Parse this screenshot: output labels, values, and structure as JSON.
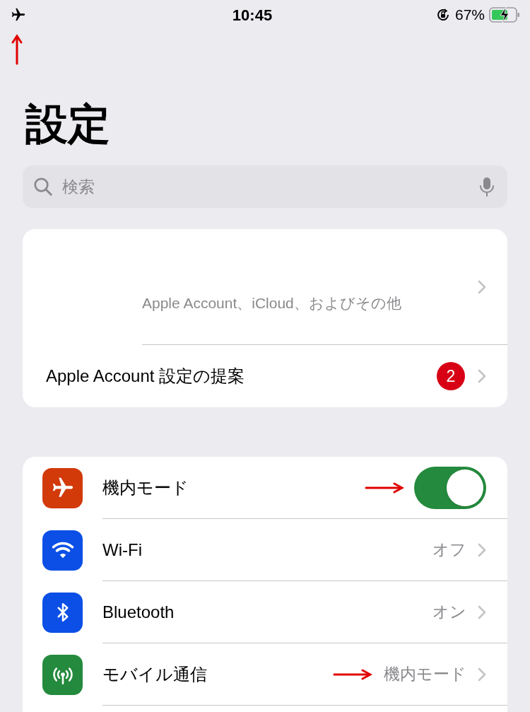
{
  "status_bar": {
    "time": "10:45",
    "battery": "67%"
  },
  "title": "設定",
  "search": {
    "placeholder": "検索"
  },
  "account": {
    "subtitle": "Apple Account、iCloud、およびその他",
    "suggestion": {
      "label": "Apple Account 設定の提案",
      "badge": "2"
    }
  },
  "settings": [
    {
      "kind": "toggle",
      "label": "機内モード",
      "color": "#d23a0a",
      "on": true
    },
    {
      "kind": "link",
      "label": "Wi-Fi",
      "color": "#0b4fe6",
      "value": "オフ"
    },
    {
      "kind": "link",
      "label": "Bluetooth",
      "color": "#0b4fe6",
      "value": "オン"
    },
    {
      "kind": "link",
      "label": "モバイル通信",
      "color": "#248a3d",
      "value": "機内モード"
    }
  ]
}
